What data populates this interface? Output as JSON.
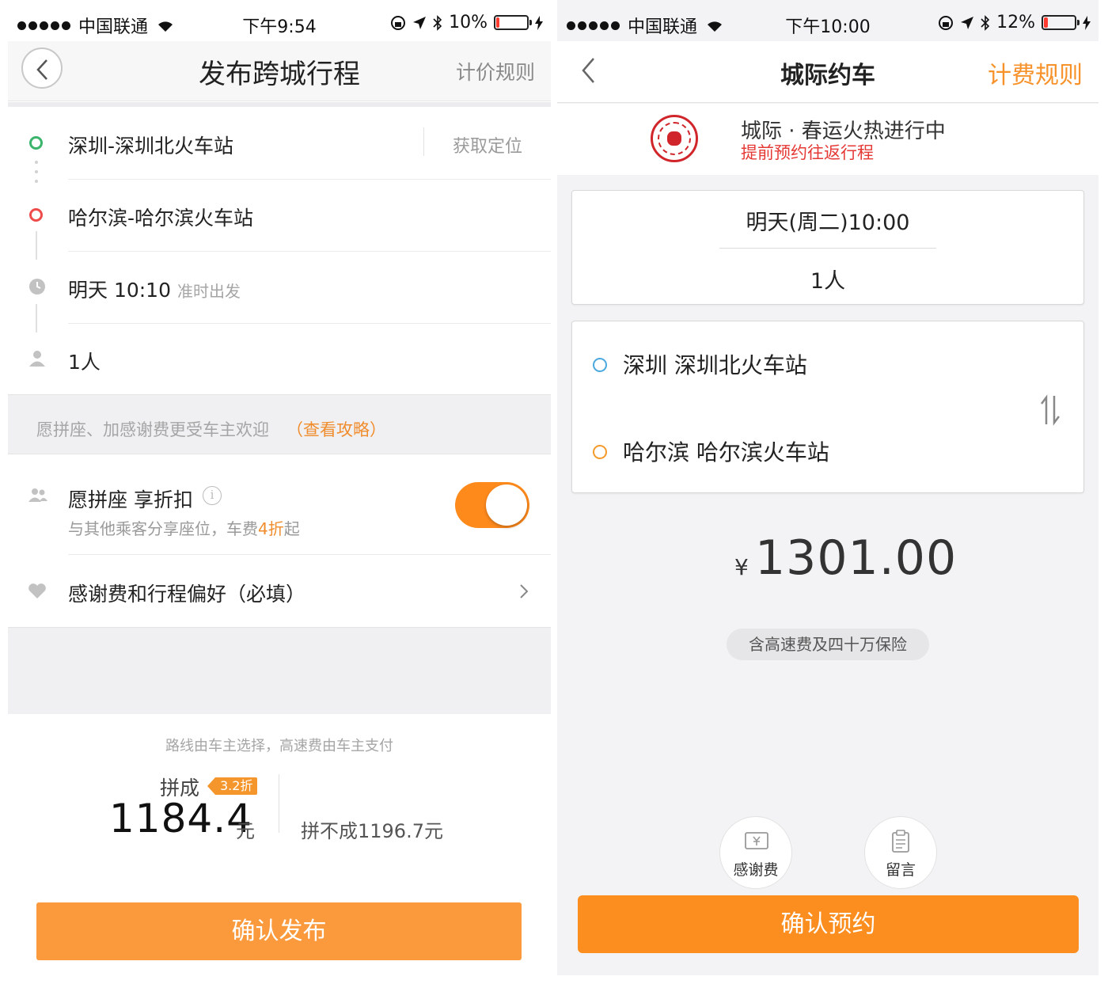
{
  "colors": {
    "accent": "#fb8e1e",
    "start_green": "#3ab56b",
    "end_red": "#ee4b4b",
    "blue_ring": "#4aa8e0",
    "orange_ring": "#f59a2a",
    "seal_red": "#d0262b"
  },
  "left": {
    "status": {
      "carrier": "中国联通",
      "time": "下午9:54",
      "battery": "10%",
      "battery_level": 0.1
    },
    "header": {
      "title": "发布跨城行程",
      "right_link": "计价规则"
    },
    "start": {
      "label": "深圳-深圳北火车站",
      "locate": "获取定位"
    },
    "end": {
      "label": "哈尔滨-哈尔滨火车站"
    },
    "time": {
      "label": "明天 10:10",
      "sub": "准时出发"
    },
    "people": {
      "label": "1人"
    },
    "tip": {
      "text": "愿拼座、加感谢费更受车主欢迎",
      "link": "（查看攻略）"
    },
    "share": {
      "title": "愿拼座 享折扣",
      "info": "i",
      "sub_a": "与其他乘客分享座位，车费",
      "sub_hl": "4折",
      "sub_b": "起",
      "enabled": true
    },
    "thanks": {
      "label": "感谢费和行程偏好（必填）"
    },
    "route_note": "路线由车主选择，高速费由车主支付",
    "price": {
      "pin_label": "拼成",
      "discount": "3.2折",
      "amount": "1184.4",
      "unit": "元",
      "alt": "拼不成1196.7元"
    },
    "confirm": "确认发布"
  },
  "right": {
    "status": {
      "carrier": "中国联通",
      "time": "下午10:00",
      "battery": "12%",
      "battery_level": 0.12
    },
    "header": {
      "title": "城际约车",
      "right_link": "计费规则"
    },
    "banner": {
      "title": "城际 · 春运火热进行中",
      "subtitle": "提前预约往返行程"
    },
    "trip": {
      "time": "明天(周二)10:00",
      "people": "1人"
    },
    "route": {
      "start": "深圳 深圳北火车站",
      "end": "哈尔滨 哈尔滨火车站"
    },
    "fare": {
      "currency": "¥",
      "amount": "1301.00",
      "note": "含高速费及四十万保险"
    },
    "actions": {
      "thanks": "感谢费",
      "message": "留言"
    },
    "confirm": "确认预约"
  }
}
